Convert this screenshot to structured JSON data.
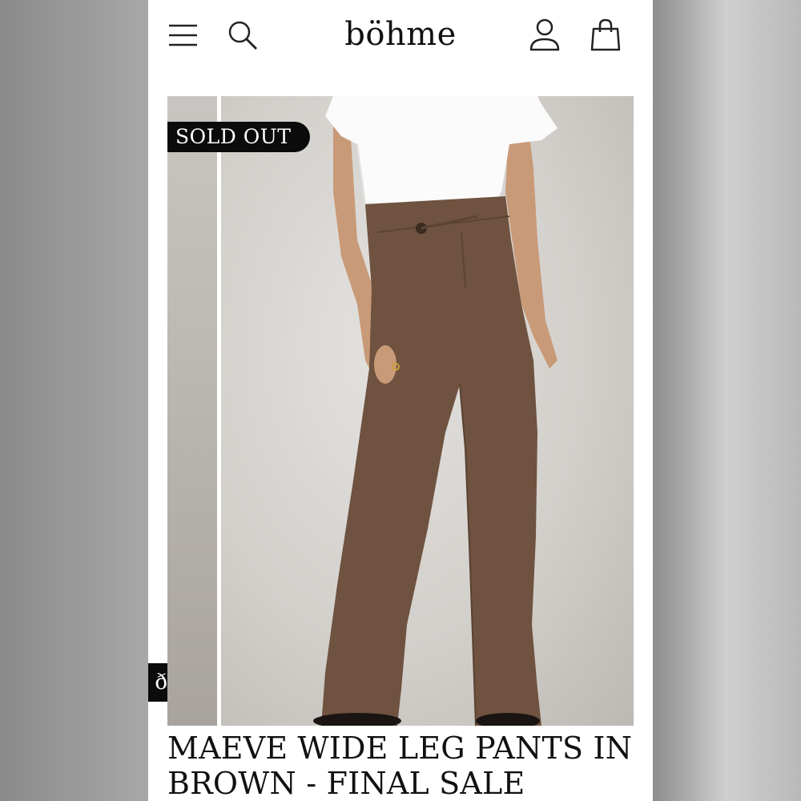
{
  "header": {
    "logo": "böhme",
    "icons": [
      "menu-icon",
      "search-icon",
      "account-icon",
      "cart-icon"
    ]
  },
  "gallery": {
    "badge": "SOLD OUT",
    "side_tab_text": "ð",
    "slide_count": 4,
    "active_index": 2
  },
  "product": {
    "title": "MAEVE WIDE LEG PANTS IN BROWN - FINAL SALE"
  },
  "colors": {
    "pants": "#6f5240",
    "background": "#ffffff",
    "badge": "#0b0b0b"
  }
}
